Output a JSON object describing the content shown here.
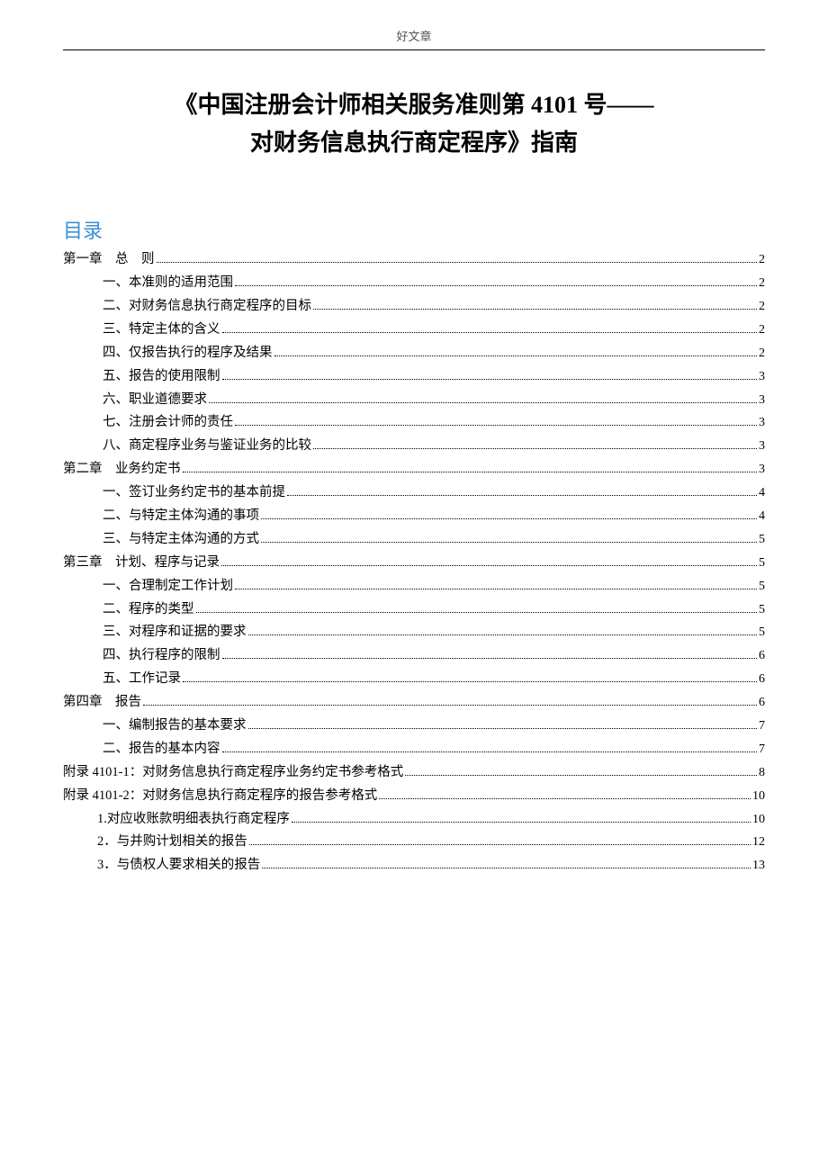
{
  "header": "好文章",
  "title_line1": "《中国注册会计师相关服务准则第 4101 号——",
  "title_line2": "对财务信息执行商定程序》指南",
  "toc_label": "目录",
  "toc": [
    {
      "text": "第一章　总　则",
      "page": "2",
      "indent": 0
    },
    {
      "text": "一、本准则的适用范围",
      "page": "2",
      "indent": 1
    },
    {
      "text": "二、对财务信息执行商定程序的目标",
      "page": "2",
      "indent": 1
    },
    {
      "text": "三、特定主体的含义",
      "page": "2",
      "indent": 1
    },
    {
      "text": "四、仅报告执行的程序及结果",
      "page": "2",
      "indent": 1
    },
    {
      "text": "五、报告的使用限制",
      "page": "3",
      "indent": 1
    },
    {
      "text": "六、职业道德要求",
      "page": "3",
      "indent": 1
    },
    {
      "text": "七、注册会计师的责任",
      "page": "3",
      "indent": 1
    },
    {
      "text": "八、商定程序业务与鉴证业务的比较",
      "page": "3",
      "indent": 1
    },
    {
      "text": "第二章　业务约定书",
      "page": "3",
      "indent": 0
    },
    {
      "text": "一、签订业务约定书的基本前提",
      "page": "4",
      "indent": 1
    },
    {
      "text": "二、与特定主体沟通的事项",
      "page": "4",
      "indent": 1
    },
    {
      "text": "三、与特定主体沟通的方式",
      "page": "5",
      "indent": 1
    },
    {
      "text": "第三章　计划、程序与记录",
      "page": "5",
      "indent": 0
    },
    {
      "text": "一、合理制定工作计划",
      "page": "5",
      "indent": 1
    },
    {
      "text": "二、程序的类型",
      "page": "5",
      "indent": 1
    },
    {
      "text": "三、对程序和证据的要求",
      "page": "5",
      "indent": 1
    },
    {
      "text": "四、执行程序的限制",
      "page": "6",
      "indent": 1
    },
    {
      "text": "五、工作记录",
      "page": "6",
      "indent": 1
    },
    {
      "text": "第四章　报告",
      "page": "6",
      "indent": 0
    },
    {
      "text": "一、编制报告的基本要求",
      "page": "7",
      "indent": 1
    },
    {
      "text": "二、报告的基本内容",
      "page": "7",
      "indent": 1
    },
    {
      "text": "附录 4101-1：对财务信息执行商定程序业务约定书参考格式",
      "page": "8",
      "indent": 0
    },
    {
      "text": "附录 4101-2：对财务信息执行商定程序的报告参考格式",
      "page": "10",
      "indent": 0
    },
    {
      "text": "1.对应收账款明细表执行商定程序",
      "page": "10",
      "indent": 2
    },
    {
      "text": "2．与并购计划相关的报告",
      "page": "12",
      "indent": 2
    },
    {
      "text": "3．与债权人要求相关的报告",
      "page": "13",
      "indent": 2
    }
  ]
}
